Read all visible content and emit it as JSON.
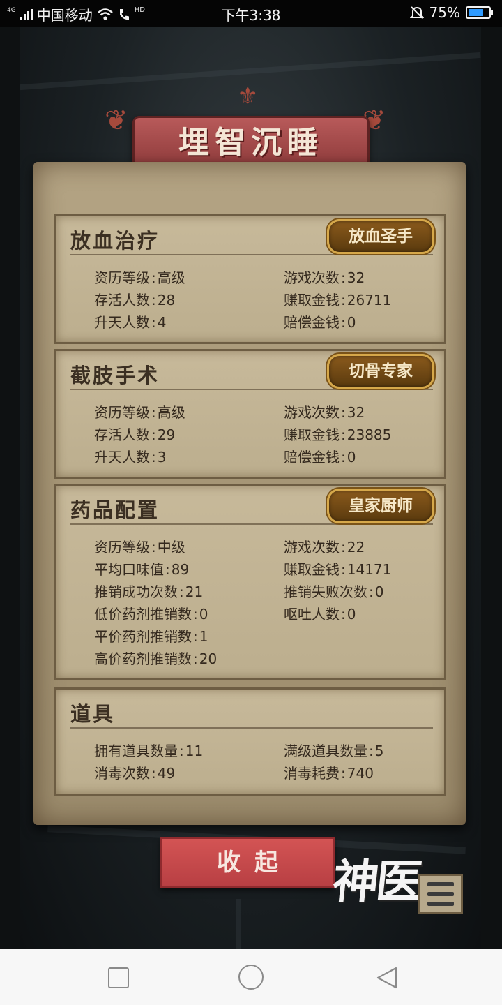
{
  "status_bar": {
    "network": "4G",
    "carrier": "中国移动",
    "time": "下午3:38",
    "hd": "HD",
    "battery": "75%",
    "battery_level": 0.75
  },
  "title": "埋智沉睡",
  "sections": [
    {
      "title": "放血治疗",
      "badge": "放血圣手",
      "left": [
        {
          "label": "资历等级",
          "value": "高级"
        },
        {
          "label": "存活人数",
          "value": "28"
        },
        {
          "label": "升天人数",
          "value": "4"
        }
      ],
      "right": [
        {
          "label": "游戏次数",
          "value": "32"
        },
        {
          "label": "赚取金钱",
          "value": "26711"
        },
        {
          "label": "赔偿金钱",
          "value": "0"
        }
      ]
    },
    {
      "title": "截肢手术",
      "badge": "切骨专家",
      "left": [
        {
          "label": "资历等级",
          "value": "高级"
        },
        {
          "label": "存活人数",
          "value": "29"
        },
        {
          "label": "升天人数",
          "value": "3"
        }
      ],
      "right": [
        {
          "label": "游戏次数",
          "value": "32"
        },
        {
          "label": "赚取金钱",
          "value": "23885"
        },
        {
          "label": "赔偿金钱",
          "value": "0"
        }
      ]
    },
    {
      "title": "药品配置",
      "badge": "皇家厨师",
      "left": [
        {
          "label": "资历等级",
          "value": "中级"
        },
        {
          "label": "平均口味值",
          "value": "89"
        },
        {
          "label": "推销成功次数",
          "value": "21"
        },
        {
          "label": "低价药剂推销数",
          "value": "0"
        },
        {
          "label": "平价药剂推销数",
          "value": "1"
        },
        {
          "label": "高价药剂推销数",
          "value": "20"
        }
      ],
      "right": [
        {
          "label": "游戏次数",
          "value": "22"
        },
        {
          "label": "赚取金钱",
          "value": "14171"
        },
        {
          "label": "推销失败次数",
          "value": "0"
        },
        {
          "label": "呕吐人数",
          "value": "0"
        }
      ]
    },
    {
      "title": "道具",
      "left": [
        {
          "label": "拥有道具数量",
          "value": "11"
        },
        {
          "label": "消毒次数",
          "value": "49"
        }
      ],
      "right": [
        {
          "label": "满级道具数量",
          "value": "5"
        },
        {
          "label": "消毒耗费",
          "value": "740"
        }
      ]
    }
  ],
  "collapse_label": "收起",
  "logo_text": "神医",
  "icons": {
    "menu": "menu-list-icon",
    "wifi": "wifi-icon",
    "alarm": "alarm-off-icon",
    "nav_recent": "square-icon",
    "nav_home": "circle-icon",
    "nav_back": "triangle-back-icon"
  },
  "colors": {
    "banner": "#8e3b3b",
    "parchment": "#a89878",
    "badge_gold": "#d6a84a",
    "collapse": "#c44a4d",
    "battery": "#2f9bff"
  }
}
